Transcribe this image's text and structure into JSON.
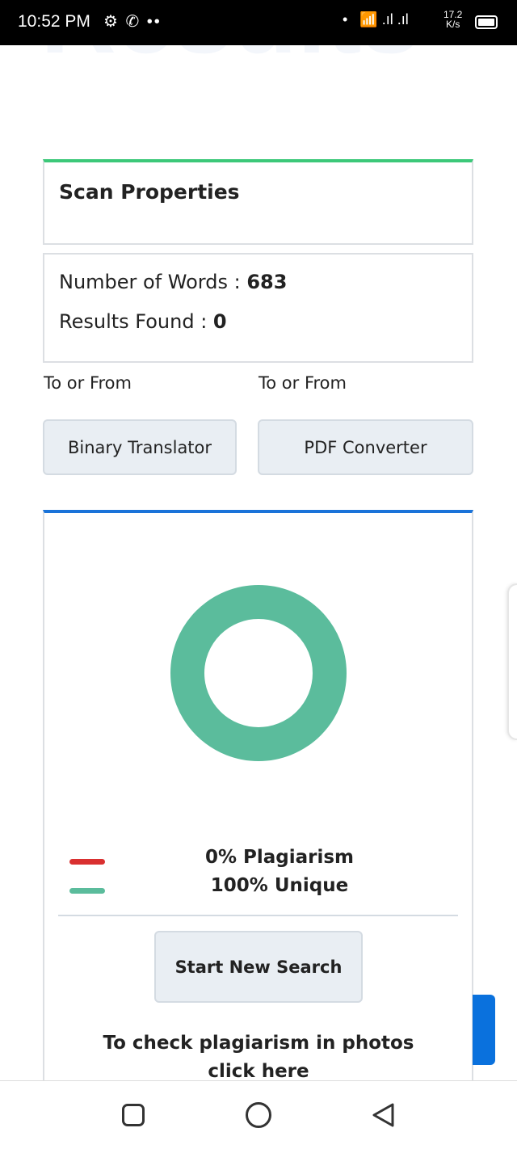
{
  "status_bar": {
    "time": "10:52 PM",
    "left_icons": "⚙ ✆ ••",
    "speed_value": "17.2",
    "speed_unit": "K/s"
  },
  "page": {
    "watermark_title": "Results"
  },
  "scan": {
    "title": "Scan Properties",
    "words_label": "Number of Words : ",
    "words_value": "683",
    "results_label": "Results Found : ",
    "results_value": "0"
  },
  "tools": [
    {
      "caption": "To or From",
      "button": "Binary Translator"
    },
    {
      "caption": "To or From",
      "button": "PDF Converter"
    }
  ],
  "result": {
    "plagiarism_percent": 0,
    "unique_percent": 100,
    "plagiarism_label": "0% Plagiarism",
    "unique_label": "100% Unique",
    "colors": {
      "plagiarism": "#d93030",
      "unique": "#5bbc9c"
    },
    "new_search": "Start New Search",
    "photos_line1": "To check plagiarism in photos",
    "photos_line2": "click here"
  }
}
